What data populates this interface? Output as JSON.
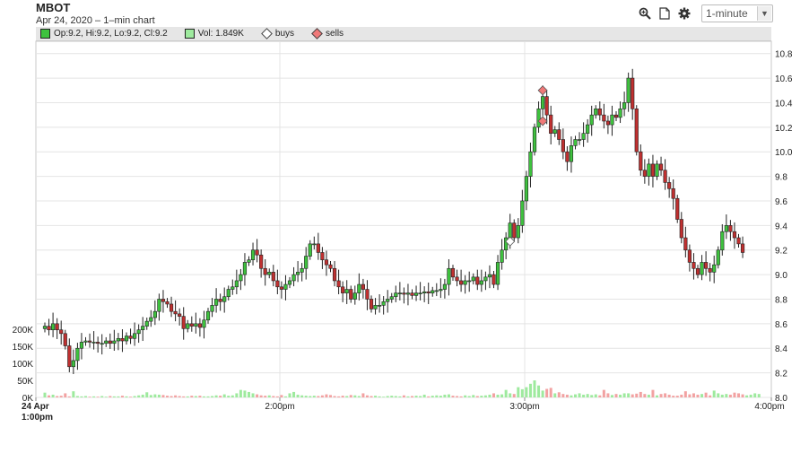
{
  "header": {
    "ticker": "MBOT",
    "subtitle": "Apr 24, 2020 – 1–min chart",
    "interval": "1-minute"
  },
  "legend": {
    "ohlc": "Op:9.2, Hi:9.2, Lo:9.2, Cl:9.2",
    "volume": "Vol: 1.849K",
    "buys": "buys",
    "sells": "sells"
  },
  "icons": [
    "zoom-icon",
    "document-icon",
    "gear-icon",
    "chevron-down-icon"
  ],
  "colors": {
    "up": "#3ec23e",
    "down": "#c03030",
    "vol_up": "#9eea9e",
    "vol_down": "#f2a2a2",
    "buy_marker": "#ffffff",
    "sell_marker": "#f07878"
  },
  "chart_data": {
    "type": "candlestick",
    "title": "MBOT",
    "x_ticks": [
      "24 Apr\n1:00pm",
      "2:00pm",
      "3:00pm",
      "4:00pm"
    ],
    "price_ylim": [
      8.0,
      10.9
    ],
    "price_ticks": [
      "10.8",
      "10.6",
      "10.4",
      "10.2",
      "10.0",
      "9.8",
      "9.6",
      "9.4",
      "9.2",
      "9.0",
      "8.8",
      "8.6",
      "8.4",
      "8.2",
      "8.0"
    ],
    "volume_ticks": [
      "200K",
      "150K",
      "100K",
      "50K",
      "0K"
    ],
    "volume_ylim": [
      0,
      200000
    ],
    "ohlc_minutes": {
      "start_minute": 0,
      "open": [
        8.56,
        8.58,
        8.55,
        8.6,
        8.55,
        8.52,
        8.42,
        8.25,
        8.3,
        8.4,
        8.45,
        8.46,
        8.45,
        8.45,
        8.44,
        8.44,
        8.46,
        8.44,
        8.46,
        8.48,
        8.46,
        8.5,
        8.48,
        8.52,
        8.55,
        8.58,
        8.62,
        8.65,
        8.7,
        8.8,
        8.78,
        8.76,
        8.7,
        8.68,
        8.66,
        8.56,
        8.6,
        8.58,
        8.6,
        8.57,
        8.63,
        8.7,
        8.75,
        8.8,
        8.78,
        8.82,
        8.88,
        8.9,
        8.95,
        9.0,
        9.1,
        9.12,
        9.2,
        9.16,
        9.05,
        9.0,
        9.02,
        8.95,
        8.9,
        8.88,
        8.92,
        8.95,
        9.0,
        9.02,
        9.05,
        9.15,
        9.25,
        9.25,
        9.18,
        9.12,
        9.08,
        9.05,
        8.95,
        8.9,
        8.85,
        8.88,
        8.8,
        8.85,
        8.92,
        8.88,
        8.8,
        8.72,
        8.75,
        8.75,
        8.78,
        8.8,
        8.82,
        8.85,
        8.85,
        8.84,
        8.85,
        8.83,
        8.85,
        8.85,
        8.86,
        8.85,
        8.87,
        8.87,
        8.88,
        8.92,
        9.05,
        8.98,
        8.95,
        8.92,
        8.95,
        8.95,
        8.98,
        8.92,
        8.95,
        8.98,
        9.0,
        8.92,
        9.1,
        9.2,
        9.3,
        9.42,
        9.3,
        9.4,
        9.6,
        9.8,
        10.0,
        10.2,
        10.35,
        10.45,
        10.3,
        10.15,
        10.18,
        10.1,
        10.0,
        9.92,
        10.05,
        10.1,
        10.1,
        10.15,
        10.22,
        10.3,
        10.35,
        10.3,
        10.25,
        10.22,
        10.3,
        10.28,
        10.35,
        10.4,
        10.6,
        10.35,
        10.0,
        9.85,
        9.8,
        9.9,
        9.8,
        9.9,
        9.85,
        9.75,
        9.7,
        9.62,
        9.45,
        9.3,
        9.2,
        9.1,
        9.05,
        9.0,
        9.1,
        9.05,
        9.02,
        9.08,
        9.2,
        9.35,
        9.4,
        9.35,
        9.3,
        9.25
      ],
      "close": [
        8.58,
        8.55,
        8.6,
        8.55,
        8.52,
        8.42,
        8.25,
        8.3,
        8.4,
        8.45,
        8.46,
        8.45,
        8.45,
        8.44,
        8.44,
        8.46,
        8.44,
        8.46,
        8.48,
        8.46,
        8.5,
        8.48,
        8.52,
        8.55,
        8.58,
        8.62,
        8.65,
        8.7,
        8.8,
        8.78,
        8.76,
        8.7,
        8.68,
        8.66,
        8.56,
        8.6,
        8.58,
        8.6,
        8.57,
        8.63,
        8.7,
        8.75,
        8.8,
        8.78,
        8.82,
        8.88,
        8.9,
        8.95,
        9.0,
        9.1,
        9.12,
        9.2,
        9.16,
        9.05,
        9.0,
        9.02,
        8.95,
        8.9,
        8.88,
        8.92,
        8.95,
        9.0,
        9.02,
        9.05,
        9.15,
        9.25,
        9.25,
        9.18,
        9.12,
        9.08,
        9.05,
        8.95,
        8.9,
        8.85,
        8.88,
        8.8,
        8.85,
        8.92,
        8.88,
        8.8,
        8.72,
        8.75,
        8.75,
        8.78,
        8.8,
        8.82,
        8.85,
        8.85,
        8.84,
        8.85,
        8.83,
        8.85,
        8.85,
        8.86,
        8.85,
        8.87,
        8.87,
        8.88,
        8.92,
        9.05,
        8.98,
        8.95,
        8.92,
        8.95,
        8.95,
        8.98,
        8.92,
        8.95,
        8.98,
        9.0,
        8.92,
        9.1,
        9.2,
        9.3,
        9.42,
        9.3,
        9.4,
        9.6,
        9.8,
        10.0,
        10.2,
        10.35,
        10.45,
        10.3,
        10.15,
        10.18,
        10.1,
        10.0,
        9.92,
        10.05,
        10.1,
        10.1,
        10.15,
        10.22,
        10.3,
        10.35,
        10.3,
        10.25,
        10.22,
        10.3,
        10.28,
        10.35,
        10.4,
        10.6,
        10.35,
        10.0,
        9.85,
        9.8,
        9.9,
        9.8,
        9.9,
        9.85,
        9.75,
        9.7,
        9.62,
        9.45,
        9.3,
        9.2,
        9.1,
        9.05,
        9.0,
        9.1,
        9.05,
        9.02,
        9.08,
        9.2,
        9.35,
        9.4,
        9.35,
        9.3,
        9.25,
        9.18
      ]
    },
    "volume": [
      14,
      6,
      8,
      4,
      5,
      12,
      3,
      18,
      4,
      3,
      4,
      2,
      3,
      2,
      4,
      2,
      4,
      3,
      3,
      5,
      3,
      2,
      4,
      6,
      8,
      15,
      7,
      9,
      8,
      7,
      5,
      4,
      6,
      4,
      3,
      3,
      5,
      4,
      5,
      3,
      3,
      4,
      6,
      5,
      9,
      5,
      6,
      12,
      22,
      20,
      16,
      12,
      9,
      6,
      5,
      6,
      4,
      3,
      7,
      3,
      12,
      16,
      8,
      6,
      5,
      4,
      5,
      4,
      6,
      9,
      7,
      4,
      3,
      5,
      4,
      7,
      6,
      4,
      12,
      6,
      4,
      5,
      3,
      2,
      4,
      5,
      4,
      3,
      6,
      3,
      4,
      5,
      4,
      8,
      3,
      5,
      6,
      5,
      8,
      9,
      5,
      4,
      3,
      6,
      4,
      7,
      4,
      5,
      6,
      8,
      12,
      8,
      9,
      22,
      12,
      10,
      30,
      24,
      30,
      40,
      50,
      35,
      20,
      25,
      28,
      12,
      15,
      10,
      8,
      6,
      9,
      12,
      8,
      10,
      7,
      9,
      6,
      22,
      12,
      7,
      10,
      8,
      12,
      12,
      9,
      11,
      16,
      10,
      8,
      22,
      6,
      10,
      12,
      8,
      5,
      5,
      8,
      18,
      9,
      12,
      8,
      10,
      14,
      6,
      20,
      12,
      8,
      10,
      8,
      14,
      12,
      9,
      6,
      8,
      12,
      10
    ]
  }
}
